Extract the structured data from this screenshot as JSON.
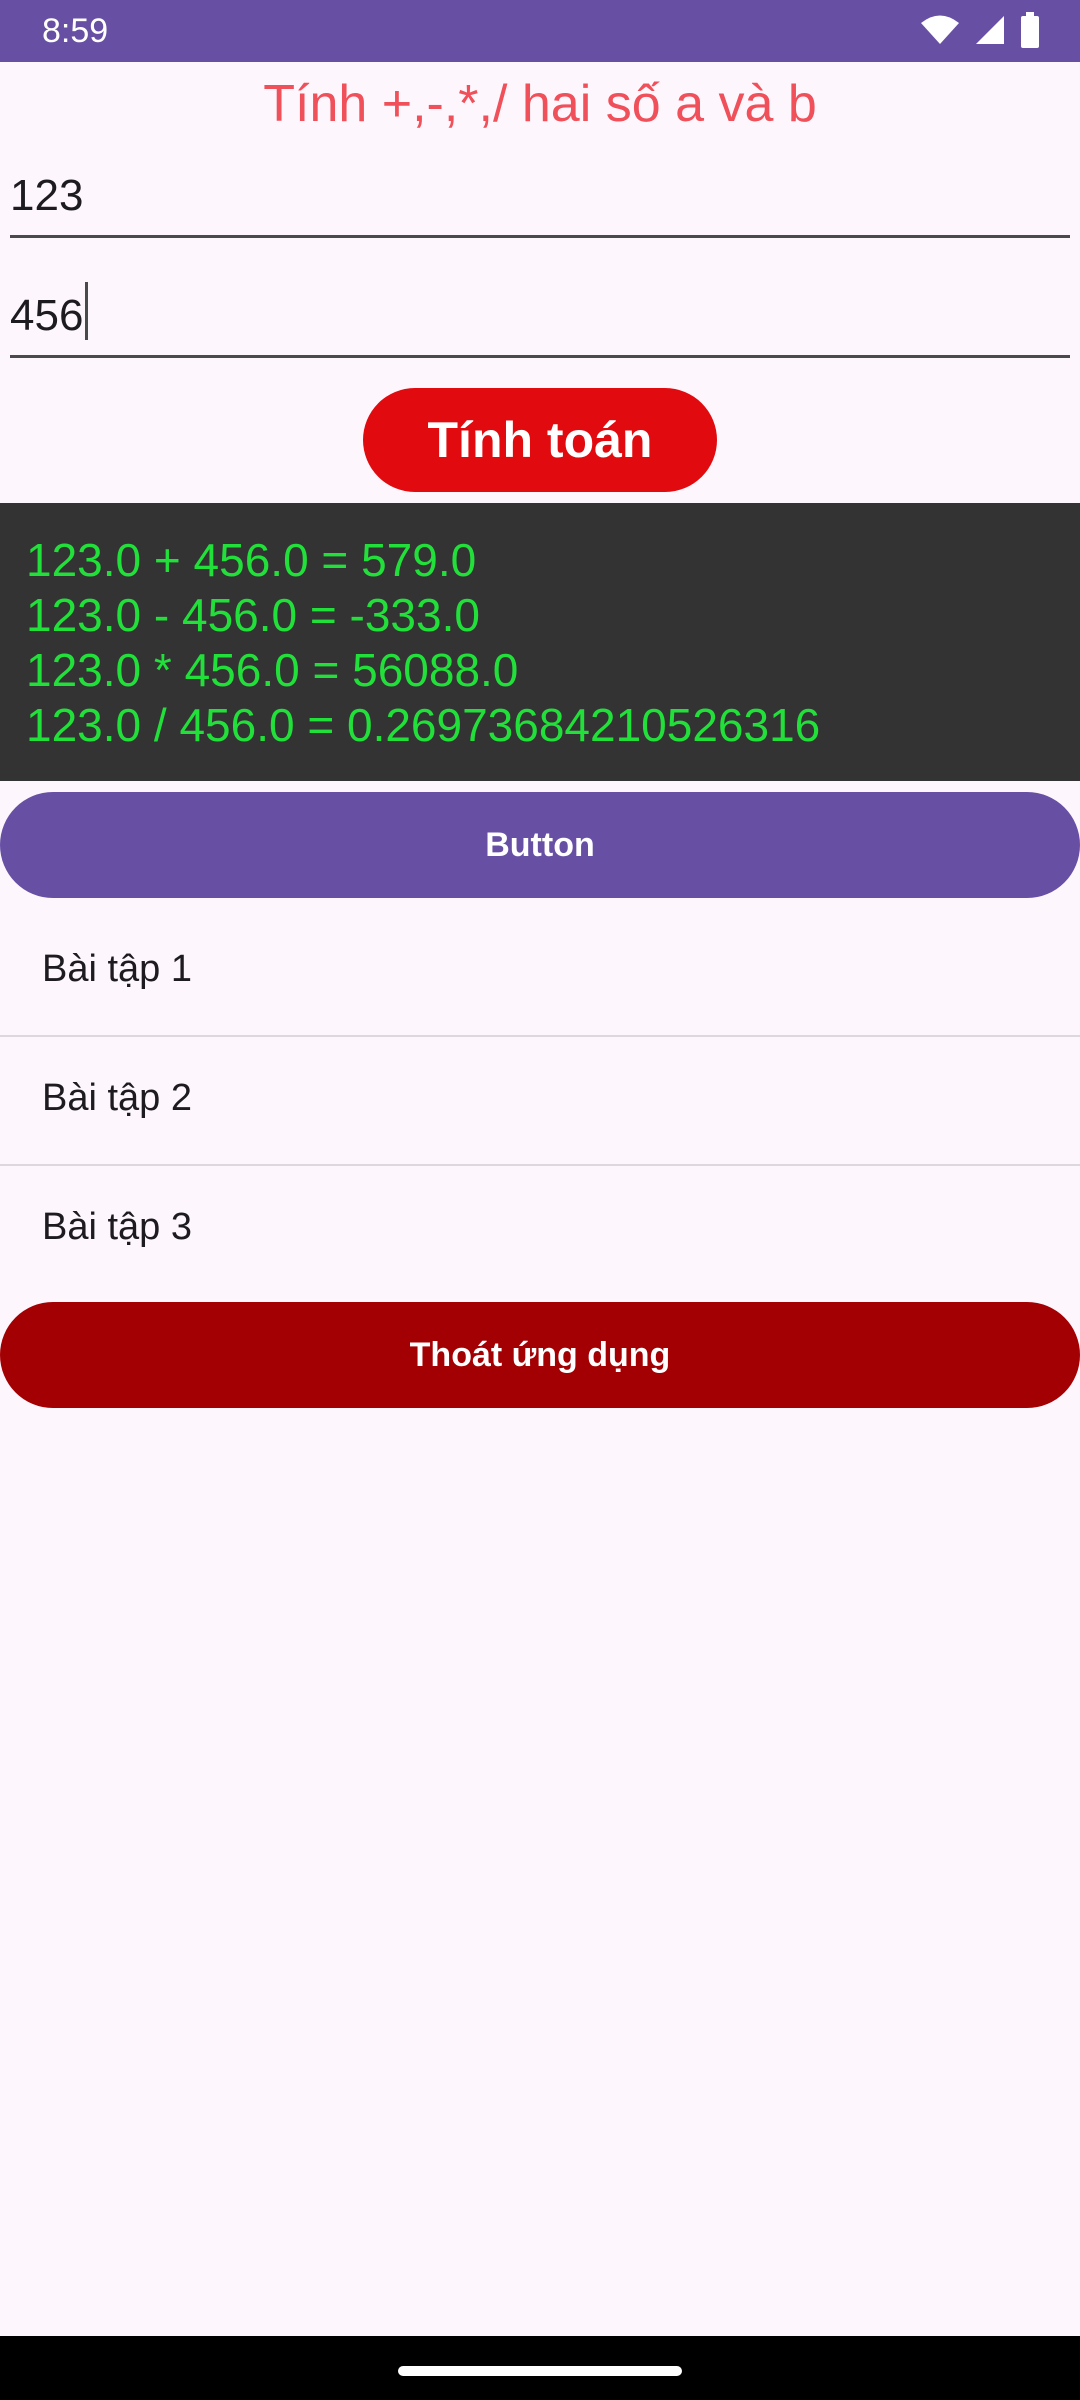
{
  "status_bar": {
    "time": "8:59",
    "icons": [
      "wifi-icon",
      "signal-icon",
      "battery-icon"
    ],
    "color": "#6750a4"
  },
  "title": "Tính +,-,*,/ hai số a và b",
  "inputs": {
    "a_value": "123",
    "b_value": "456"
  },
  "calc_button_label": "Tính toán",
  "results": [
    "123.0 + 456.0 = 579.0",
    "123.0 - 456.0 = -333.0",
    "123.0 * 456.0 = 56088.0",
    "123.0 / 456.0 = 0.26973684210526316"
  ],
  "generic_button_label": "Button",
  "exercise_list": [
    {
      "label": "Bài tập 1"
    },
    {
      "label": "Bài tập 2"
    },
    {
      "label": "Bài tập 3"
    }
  ],
  "exit_button_label": "Thoát ứng dụng",
  "colors": {
    "title": "#f0505a",
    "calc_button": "#e10a0e",
    "result_bg": "#333333",
    "result_text": "#22e03a",
    "primary": "#6750a4",
    "exit_button": "#a30003"
  }
}
